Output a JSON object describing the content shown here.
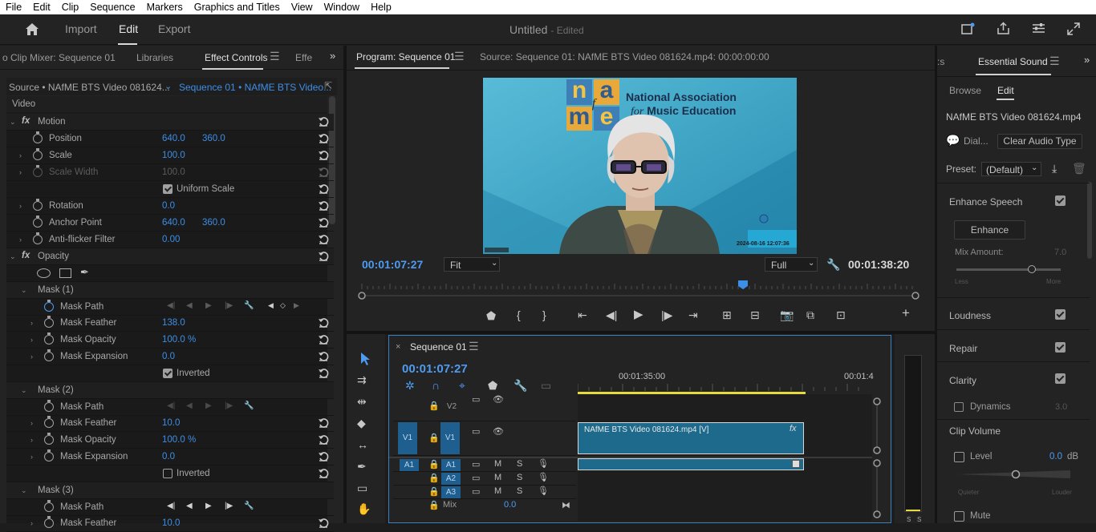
{
  "menu": [
    "File",
    "Edit",
    "Clip",
    "Sequence",
    "Markers",
    "Graphics and Titles",
    "View",
    "Window",
    "Help"
  ],
  "workspace": {
    "import": "Import",
    "edit": "Edit",
    "export": "Export"
  },
  "app_title": {
    "name": "Untitled",
    "status": "- Edited"
  },
  "left_tabs": {
    "mixer": "o Clip Mixer: Sequence 01",
    "libraries": "Libraries",
    "effect_controls": "Effect Controls",
    "effects": "Effe"
  },
  "ec": {
    "source": "Source • NAfME BTS Video 081624...",
    "sequence": "Sequence 01 • NAfME BTS Video...",
    "video": "Video",
    "motion": "Motion",
    "fx": "fx",
    "position": {
      "label": "Position",
      "x": "640.0",
      "y": "360.0"
    },
    "scale": {
      "label": "Scale",
      "value": "100.0"
    },
    "scale_width": {
      "label": "Scale Width",
      "value": "100.0"
    },
    "uniform": "Uniform Scale",
    "rotation": {
      "label": "Rotation",
      "value": "0.0"
    },
    "anchor": {
      "label": "Anchor Point",
      "x": "640.0",
      "y": "360.0"
    },
    "antiflicker": {
      "label": "Anti-flicker Filter",
      "value": "0.00"
    },
    "opacity": "Opacity",
    "mask1": {
      "title": "Mask (1)",
      "path": "Mask Path",
      "feather": "Mask Feather",
      "feather_v": "138.0",
      "opacity": "Mask Opacity",
      "opacity_v": "100.0 %",
      "expansion": "Mask Expansion",
      "expansion_v": "0.0",
      "inverted": "Inverted"
    },
    "mask2": {
      "title": "Mask (2)",
      "path": "Mask Path",
      "feather": "Mask Feather",
      "feather_v": "10.0",
      "opacity": "Mask Opacity",
      "opacity_v": "100.0 %",
      "expansion": "Mask Expansion",
      "expansion_v": "0.0",
      "inverted": "Inverted"
    },
    "mask3": {
      "title": "Mask (3)",
      "path": "Mask Path",
      "feather": "Mask Feather",
      "feather_v": "10.0"
    }
  },
  "program": {
    "tab": "Program: Sequence 01",
    "source_tab": "Source: Sequence 01: NAfME BTS Video 081624.mp4: 00:00:00:00",
    "timecode": "00:01:07:27",
    "fit": "Fit",
    "quality": "Full",
    "duration": "00:01:38:20",
    "logo_letters": [
      "n",
      "a",
      "m",
      "e"
    ],
    "logo_f": "f",
    "org_line1": "National Association",
    "org_line2_for": "for",
    "org_line2": "Music Education",
    "stamp": "2024-08-16  12:07:36"
  },
  "timeline": {
    "tab": "Sequence 01",
    "timecode": "00:01:07:27",
    "ruler_1": "00:01:35:00",
    "ruler_2": "00:01:4",
    "tracks": {
      "v2": "V2",
      "v1": "V1",
      "v1src": "V1",
      "a1": "A1",
      "a1src": "A1",
      "a2": "A2",
      "a3": "A3",
      "mix": "Mix",
      "mix_v": "0.0",
      "m": "M",
      "s": "S"
    },
    "clip_label": "NAfME BTS Video 081624.mp4 [V]",
    "clip_fx": "fx",
    "meter_s": "S"
  },
  "essential": {
    "tab": "Essential Sound",
    "tab_prev": ":s",
    "browse": "Browse",
    "edit": "Edit",
    "clip": "NAfME BTS Video 081624.mp4",
    "dial": "Dial...",
    "clear": "Clear Audio Type",
    "preset_label": "Preset:",
    "preset": "(Default)",
    "enhance_speech": "Enhance Speech",
    "enhance_btn": "Enhance",
    "mix_amount": "Mix Amount:",
    "mix_amount_v": "7.0",
    "less": "Less",
    "more": "More",
    "loudness": "Loudness",
    "repair": "Repair",
    "clarity": "Clarity",
    "dynamics": "Dynamics",
    "dynamics_v": "3.0",
    "clip_volume": "Clip Volume",
    "level": "Level",
    "level_v": "0.0",
    "db": "dB",
    "quieter": "Quieter",
    "louder": "Louder",
    "mute": "Mute"
  },
  "colors": {
    "accent": "#3d8ee6",
    "clip": "#1e6a8c",
    "playhead": "#3d8ee6"
  }
}
